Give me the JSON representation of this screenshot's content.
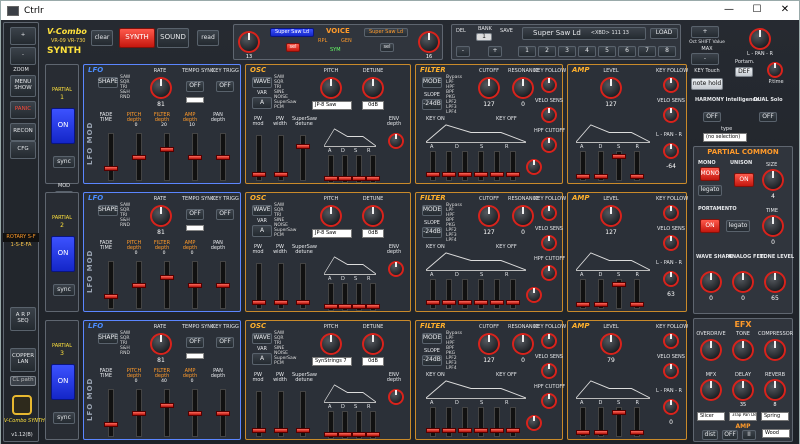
{
  "window": {
    "title": "Ctrlr",
    "min": "—",
    "max": "☐",
    "close": "✕"
  },
  "left": {
    "brand": "V-Combo",
    "brand2": "VR-09 VR-730",
    "logo": "SYNTH",
    "plus": "+",
    "minus": "-",
    "zoom": "ZOOM",
    "menu_show": "MENU SHOW",
    "panic": "PANIC",
    "recon": "RECON",
    "cfg": "CFG",
    "rotary": "ROTARY S-F",
    "rotary_val": "1-S-E-FA",
    "arp": "A R P SEQ",
    "copper": "COPPER LAN",
    "clpath": "CL path",
    "footer": "V-Combo SYNTH",
    "version": "v1.12(B)",
    "mod_title": "MOD",
    "mod_off": "OFF",
    "mod_text": "partial1 MOD partial2"
  },
  "header": {
    "clear": "clear",
    "synth": "SYNTH",
    "sound": "SOUND",
    "read": "read",
    "voice": "VOICE",
    "patch_left": "Super Saw Ld",
    "patch_right": "Super Saw Ld",
    "knob_left": "13",
    "knob_right": "16",
    "sel": "sel",
    "rpl": "RPL",
    "gen": "GEN",
    "sym": "SYM",
    "tb_l": "TREBLE",
    "tb_r": "BASS"
  },
  "bank": {
    "del": "DEL",
    "bank": "BANK",
    "bank_val": "1",
    "save": "SAVE",
    "name": "Super Saw Ld",
    "info": "<XBD> 111 13",
    "load": "LOAD",
    "minus": "-",
    "plus": "+",
    "slots": [
      "1",
      "2",
      "3",
      "4",
      "5",
      "6",
      "7",
      "8"
    ]
  },
  "right_top": {
    "oct_label": "Oct SHIFT Value",
    "max": "MAX",
    "key_touch": "KEY Touch",
    "note_hold": "note hold",
    "portam": "Portam.",
    "def": "DEF",
    "pan": "L - PAN - R",
    "ptime": "P.time",
    "plus": "+",
    "minus": "-",
    "harmony": "HARMONY Intelligence",
    "dual": "DUAL Solo",
    "h_off": "OFF",
    "d_off": "OFF",
    "type": "type",
    "type_val": "(no selection)"
  },
  "partial_common": {
    "title": "PARTIAL COMMON",
    "mono": "MONO",
    "mono_btn": "MONO",
    "legato": "legato",
    "unison": "UNISON",
    "on": "ON",
    "size": "SIZE",
    "size_val": "4",
    "portamento": "PORTAMENTO",
    "p_on": "ON",
    "p_legato": "legato",
    "time": "TIME",
    "time_val": "0",
    "wave": "WAVE SHAPE",
    "feel": "ANALOG FEEL",
    "tone": "TONE LEVEL",
    "wave_val": "0",
    "feel_val": "0",
    "tone_val": "65"
  },
  "efx": {
    "title": "EFX",
    "overdrive": "OVERDRIVE",
    "tone": "TONE",
    "compressor": "COMPRESSOR",
    "mfx": "MFX",
    "delay": "DELAY",
    "reverb": "REVERB",
    "od_val": "",
    "tone_val": "",
    "comp_val": "",
    "mfx_val": "",
    "delay_val": "35",
    "rev_val": "8",
    "slicer": "Slicer",
    "tap": "3Tap Pan Delay",
    "spring": "Spring",
    "amp": "AMP",
    "wood": "Wood",
    "sw": "OFF",
    "sw2": "II",
    "amp_sw": "dist",
    "amp_type": "TYPE",
    "amp_sub": "SW",
    "amp_onoff": "ON",
    "amp_knob": "II",
    "p1": "AMP",
    "amp_label": "AMP"
  },
  "labels": {
    "lfo": "LFO",
    "osc": "OSC",
    "filter": "FILTER",
    "amp": "AMP",
    "partial": "PARTIAL",
    "lfomod": "LFO MOD",
    "shape": "SHAPE",
    "rate": "RATE",
    "tempo": "TEMPO SYNC",
    "keytrig": "KEY TRIGG",
    "off": "OFF",
    "wave": "WAVE",
    "var": "VAR",
    "pitch": "PITCH",
    "detune": "DETUNE",
    "mode": "MODE",
    "slope": "SLOPE",
    "cutoff": "CUTOFF",
    "reso": "RESONANCE",
    "keyf": "KEY FOLLOW",
    "level": "LEVEL",
    "velo": "VELO SENS",
    "pw": "PW mod",
    "pwd": "PW width",
    "ssaw": "SuperSaw detune",
    "envd": "ENV depth",
    "fade": "FADE TIME",
    "pitchd": "PITCH depth",
    "filterd": "FILTER depth",
    "ampd": "AMP depth",
    "pand": "PAN depth",
    "hpf": "HPF CUTOFF",
    "db": "-24dB",
    "db2": "0dB",
    "lr": "L - PAN - R",
    "sync": "sync",
    "on": "ON",
    "a": "A",
    "shape_list": [
      "SAW",
      "SQR",
      "TRI",
      "S&H",
      "RND"
    ],
    "wave_list": [
      "SAW",
      "SQR",
      "TRI",
      "SINE",
      "NOISE",
      "SuperSaw",
      "PCM"
    ],
    "filter_list": [
      "Bypass",
      "LPF",
      "HPF",
      "BPF",
      "PKG",
      "LPF2",
      "LPF3",
      "LPF4"
    ],
    "adsr": [
      "A",
      "D",
      "S",
      "R"
    ],
    "keyon": "KEY ON",
    "keyoff": "KEY OFF"
  },
  "partials": [
    {
      "num": "1",
      "on": "ON",
      "rate": "81",
      "pitch": "0",
      "detune": "0",
      "wavename": "JP-8 Saw",
      "db": "0dB",
      "cutoff": "127",
      "reso": "0",
      "level": "127",
      "pan": "-64",
      "f1": "0",
      "f2": "0",
      "f3": "20",
      "f4": "10",
      "pv": "64",
      "wave_v": "3"
    },
    {
      "num": "2",
      "on": "ON",
      "rate": "81",
      "pitch": "0",
      "detune": "0",
      "wavename": "JP-8 Saw",
      "db": "0dB",
      "cutoff": "127",
      "reso": "0",
      "level": "127",
      "pan": "63",
      "f1": "0",
      "f2": "0",
      "f3": "0",
      "f4": "0",
      "pv": "127",
      "wave_v": "0"
    },
    {
      "num": "3",
      "on": "ON",
      "rate": "81",
      "pitch": "0",
      "detune": "0",
      "wavename": "SynStrings 7",
      "db": "0dB",
      "cutoff": "127",
      "reso": "0",
      "level": "79",
      "pan": "0",
      "f1": "0",
      "f2": "0",
      "f3": "40",
      "f4": "0",
      "pv": "0",
      "wave_v": "0"
    }
  ]
}
